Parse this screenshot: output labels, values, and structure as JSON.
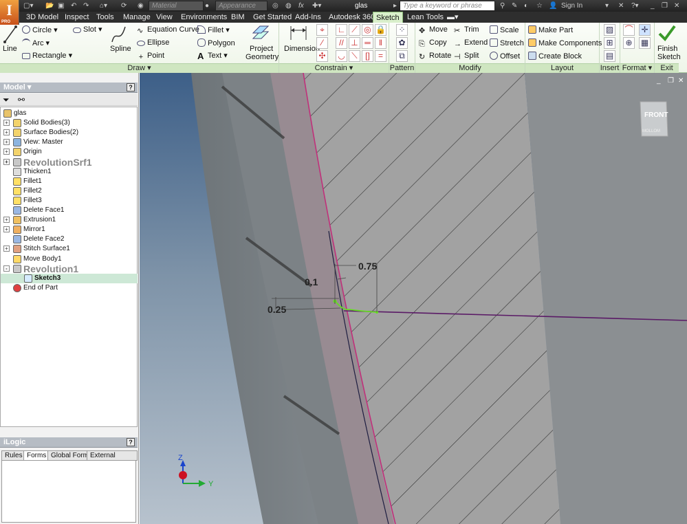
{
  "app": {
    "logo": "I",
    "logo_sub": "PRO"
  },
  "title_bar": {
    "material_placeholder": "Material",
    "appearance_placeholder": "Appearance",
    "fx": "fx",
    "document_title": "glas",
    "search_placeholder": "Type a keyword or phrase",
    "sign_in": "Sign In"
  },
  "tabs": [
    "3D Model",
    "Inspect",
    "Tools",
    "Manage",
    "View",
    "Environments",
    "BIM",
    "Get Started",
    "Add-Ins",
    "Autodesk 360",
    "Sketch",
    "Lean Tools"
  ],
  "active_tab": "Sketch",
  "ribbon": {
    "draw": {
      "label": "Draw",
      "line": "Line",
      "circle": "Circle",
      "arc": "Arc",
      "rectangle": "Rectangle",
      "slot": "Slot",
      "spline": "Spline",
      "equation_curve": "Equation Curve",
      "ellipse": "Ellipse",
      "point": "Point",
      "fillet": "Fillet",
      "polygon": "Polygon",
      "text": "Text",
      "project_geometry_1": "Project",
      "project_geometry_2": "Geometry"
    },
    "constrain": {
      "label": "Constrain",
      "dimension": "Dimension"
    },
    "pattern": {
      "label": "Pattern"
    },
    "modify": {
      "label": "Modify",
      "move": "Move",
      "copy": "Copy",
      "rotate": "Rotate",
      "trim": "Trim",
      "extend": "Extend",
      "split": "Split",
      "scale": "Scale",
      "stretch": "Stretch",
      "offset": "Offset"
    },
    "layout": {
      "label": "Layout",
      "make_part": "Make Part",
      "make_components": "Make Components",
      "create_block": "Create Block"
    },
    "insert": {
      "label": "Insert"
    },
    "format": {
      "label": "Format"
    },
    "exit": {
      "label": "Exit",
      "finish_1": "Finish",
      "finish_2": "Sketch"
    }
  },
  "model_browser": {
    "title": "Model",
    "help": "?",
    "items": [
      {
        "label": "glas",
        "indent": 0,
        "icon": "part",
        "expand": ""
      },
      {
        "label": "Solid Bodies(3)",
        "indent": 1,
        "icon": "folder",
        "expand": "+"
      },
      {
        "label": "Surface Bodies(2)",
        "indent": 1,
        "icon": "folder",
        "expand": "+"
      },
      {
        "label": "View: Master",
        "indent": 1,
        "icon": "view",
        "expand": "+"
      },
      {
        "label": "Origin",
        "indent": 1,
        "icon": "folder",
        "expand": "+"
      },
      {
        "label": "RevolutionSrf1",
        "indent": 1,
        "icon": "revolve",
        "expand": "+",
        "dim": true
      },
      {
        "label": "Thicken1",
        "indent": 1,
        "icon": "thicken",
        "expand": ""
      },
      {
        "label": "Fillet1",
        "indent": 1,
        "icon": "fillet",
        "expand": ""
      },
      {
        "label": "Fillet2",
        "indent": 1,
        "icon": "fillet",
        "expand": ""
      },
      {
        "label": "Fillet3",
        "indent": 1,
        "icon": "fillet",
        "expand": ""
      },
      {
        "label": "Delete Face1",
        "indent": 1,
        "icon": "delete",
        "expand": ""
      },
      {
        "label": "Extrusion1",
        "indent": 1,
        "icon": "extrude",
        "expand": "+"
      },
      {
        "label": "Mirror1",
        "indent": 1,
        "icon": "mirror",
        "expand": "+"
      },
      {
        "label": "Delete Face2",
        "indent": 1,
        "icon": "delete",
        "expand": ""
      },
      {
        "label": "Stitch Surface1",
        "indent": 1,
        "icon": "stitch",
        "expand": "+"
      },
      {
        "label": "Move Body1",
        "indent": 1,
        "icon": "move",
        "expand": ""
      },
      {
        "label": "Revolution1",
        "indent": 1,
        "icon": "revolve",
        "expand": "-",
        "dim": true
      },
      {
        "label": "Sketch3",
        "indent": 2,
        "icon": "sketch",
        "expand": "",
        "selected": true
      },
      {
        "label": "End of Part",
        "indent": 1,
        "icon": "end",
        "expand": ""
      }
    ]
  },
  "ilogic": {
    "title": "iLogic",
    "help": "?",
    "tabs": [
      "Rules",
      "Forms",
      "Global Forms",
      "External Rules"
    ],
    "active_tab": "Forms"
  },
  "viewport": {
    "view_cube_label": "FRONT",
    "view_cube_back": "MOLLOM",
    "dimensions": [
      "0.75",
      "0.1",
      "0.25"
    ],
    "axis_z": "Z",
    "axis_y": "Y"
  },
  "colors": {
    "ribbon_green": "#cfe6c1",
    "sketch_magenta": "#c0307a",
    "sketch_green": "#66dd22",
    "axis_line": "#5a1a66",
    "active_tab": "#d9efcb"
  }
}
